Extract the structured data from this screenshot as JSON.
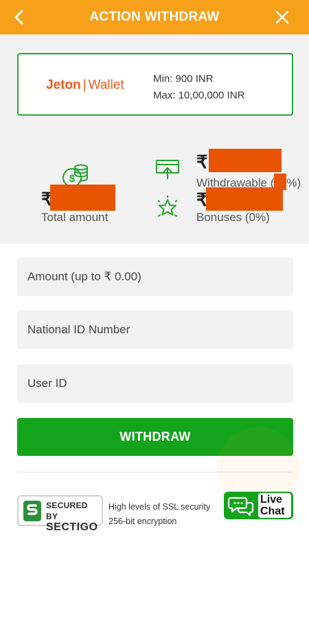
{
  "header": {
    "title": "ACTION WITHDRAW",
    "back_icon": "chevron-left-icon",
    "close_icon": "close-icon",
    "bg_color": "#f7a11a"
  },
  "payment_method": {
    "logo_brand": "Jeton",
    "logo_separator": "|",
    "logo_product": "Wallet",
    "min_label": "Min: 900 INR",
    "max_label": "Max: 10,00,000 INR",
    "border_color": "#27a935"
  },
  "balances": {
    "total": {
      "currency": "₹",
      "label": "Total amount",
      "icon": "coins-icon"
    },
    "withdrawable": {
      "currency": "₹",
      "label": "Withdrawable (",
      "label_suffix": "%)",
      "icon": "withdraw-screen-icon"
    },
    "bonuses": {
      "currency": "₹",
      "label": "Bonuses (0%)",
      "icon": "star-icon"
    },
    "redaction_color": "#e85400"
  },
  "form": {
    "amount_placeholder": "Amount (up to ₹ 0.00)",
    "national_id_placeholder": "National ID Number",
    "user_id_placeholder": "User ID",
    "submit_label": "WITHDRAW",
    "submit_color": "#14a41c"
  },
  "footer": {
    "badge_line1": "SECURED BY",
    "badge_line2": "SECTIGO",
    "ssl_line1": "High levels of SSL security",
    "ssl_line2": "256-bit encryption",
    "livechat_line1": "Live",
    "livechat_line2": "Chat",
    "livechat_icon": "chat-bubbles-icon"
  }
}
